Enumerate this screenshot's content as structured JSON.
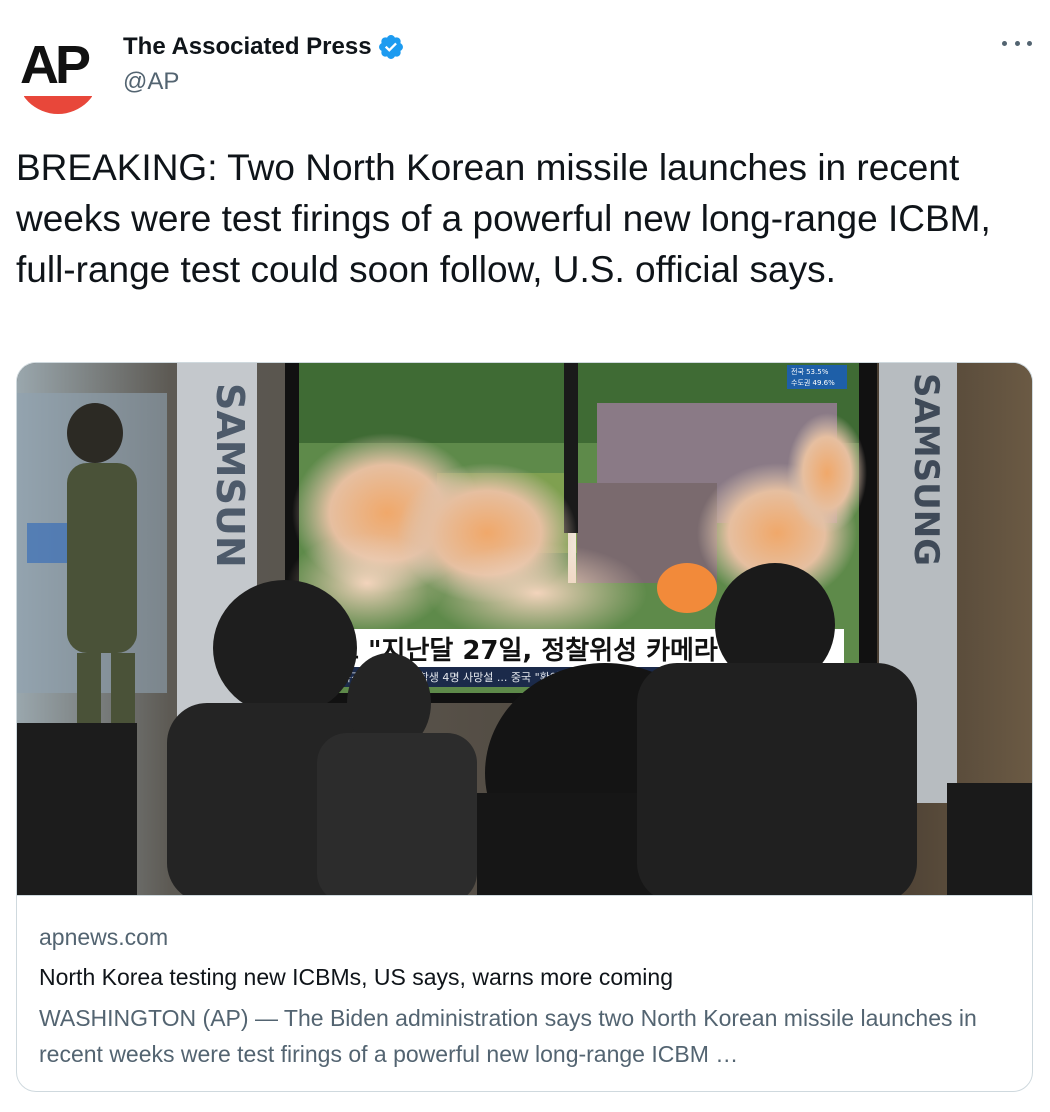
{
  "author": {
    "display_name": "The Associated Press",
    "handle": "@AP",
    "avatar_text": "AP",
    "verified": true,
    "verified_icon": "verified-badge-icon",
    "brand_color": "#e8473a",
    "verified_color": "#1d9bf0"
  },
  "more_icon": "more-options-icon",
  "tweet": {
    "text": "BREAKING: Two North Korean missile launches in recent weeks were test firings of a powerful new long-range ICBM, full-range test could soon follow, U.S. official says."
  },
  "card": {
    "image": {
      "screen_headline": "보 \"지난달 27일, 정찰위성 카메라 시",
      "ticker": "러시아 폭격으로 중국 유학생 4명 사망설 ... 중국 \"확인 중",
      "side_brand": "SAMSUNG",
      "stats": [
        "전국 53.5%",
        "수도권 49.6%"
      ]
    },
    "domain": "apnews.com",
    "title": "North Korea testing new ICBMs, US says, warns more coming",
    "description": "WASHINGTON (AP) — The Biden administration says two North Korean missile launches in recent weeks were test firings of a powerful new long-range ICBM …"
  }
}
